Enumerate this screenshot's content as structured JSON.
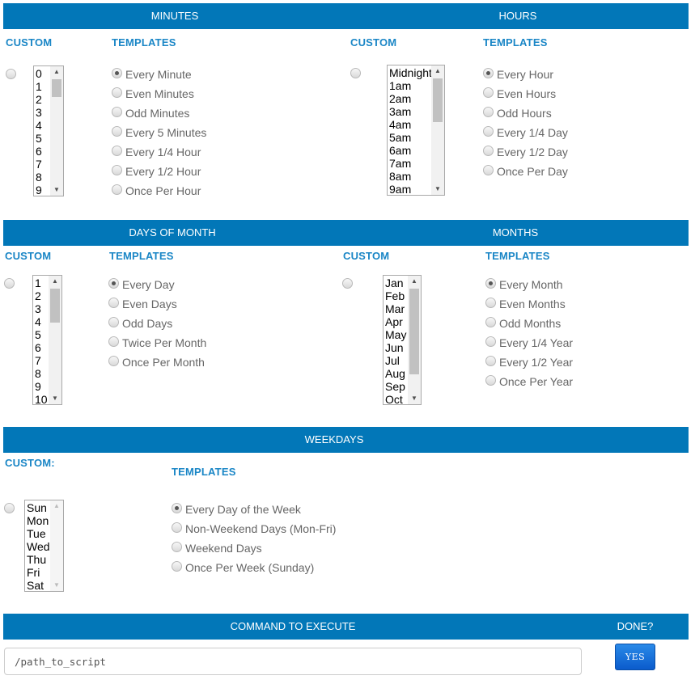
{
  "minutes": {
    "header": "MINUTES",
    "custom_label": "CUSTOM",
    "templates_label": "TEMPLATES",
    "list_items": [
      "0",
      "1",
      "2",
      "3",
      "4",
      "5",
      "6",
      "7",
      "8",
      "9"
    ],
    "templates": [
      "Every Minute",
      "Even Minutes",
      "Odd Minutes",
      "Every 5 Minutes",
      "Every 1/4 Hour",
      "Every 1/2 Hour",
      "Once Per Hour"
    ],
    "selected_template": "Every Minute"
  },
  "hours": {
    "header": "HOURS",
    "custom_label": "CUSTOM",
    "templates_label": "TEMPLATES",
    "list_items": [
      "Midnight",
      "1am",
      "2am",
      "3am",
      "4am",
      "5am",
      "6am",
      "7am",
      "8am",
      "9am"
    ],
    "templates": [
      "Every Hour",
      "Even Hours",
      "Odd Hours",
      "Every 1/4 Day",
      "Every 1/2 Day",
      "Once Per Day"
    ],
    "selected_template": "Every Hour"
  },
  "days_of_month": {
    "header": "DAYS OF MONTH",
    "custom_label": "CUSTOM",
    "templates_label": "TEMPLATES",
    "list_items": [
      "1",
      "2",
      "3",
      "4",
      "5",
      "6",
      "7",
      "8",
      "9",
      "10"
    ],
    "templates": [
      "Every Day",
      "Even Days",
      "Odd Days",
      "Twice Per Month",
      "Once Per Month"
    ],
    "selected_template": "Every Day"
  },
  "months": {
    "header": "MONTHS",
    "custom_label": "CUSTOM",
    "templates_label": "TEMPLATES",
    "list_items": [
      "Jan",
      "Feb",
      "Mar",
      "Apr",
      "May",
      "Jun",
      "Jul",
      "Aug",
      "Sep",
      "Oct"
    ],
    "templates": [
      "Every Month",
      "Even Months",
      "Odd Months",
      "Every 1/4 Year",
      "Every 1/2 Year",
      "Once Per Year"
    ],
    "selected_template": "Every Month"
  },
  "weekdays": {
    "header": "WEEKDAYS",
    "custom_label": "CUSTOM:",
    "templates_label": "TEMPLATES",
    "list_items": [
      "Sun",
      "Mon",
      "Tue",
      "Wed",
      "Thu",
      "Fri",
      "Sat"
    ],
    "templates": [
      "Every Day of the Week",
      "Non-Weekend Days (Mon-Fri)",
      "Weekend Days",
      "Once Per Week (Sunday)"
    ],
    "selected_template": "Every Day of the Week"
  },
  "command": {
    "header": "COMMAND TO EXECUTE",
    "done_label": "DONE?",
    "value": "/path_to_script",
    "yes_label": "YES"
  }
}
